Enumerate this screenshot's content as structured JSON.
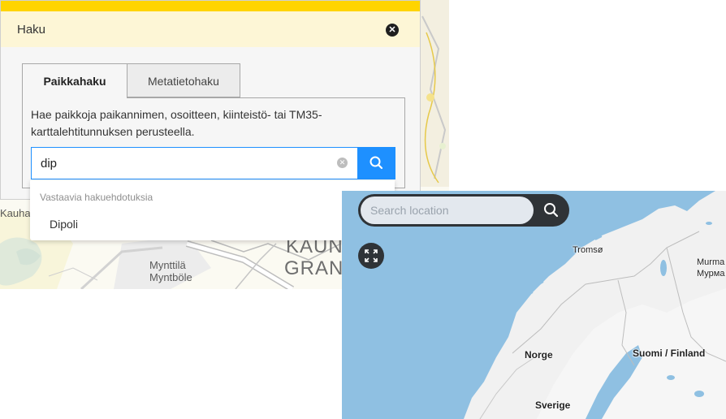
{
  "panel": {
    "title": "Haku",
    "close_icon": "close-icon",
    "accent_color": "#ffd400",
    "tabs": [
      {
        "label": "Paikkahaku",
        "active": true
      },
      {
        "label": "Metatietohaku",
        "active": false
      }
    ],
    "help_text": "Hae paikkoja paikannimen, osoitteen, kiinteistö- tai TM35-karttalehtitunnuksen perusteella.",
    "search": {
      "value": "dip",
      "clear_icon": "clear-icon",
      "button_icon": "search-icon",
      "button_color": "#1e90ff"
    },
    "suggestions": {
      "heading": "Vastaavia hakuehdotuksia",
      "items": [
        "Dipoli"
      ]
    }
  },
  "background_map": {
    "labels": [
      "Kauhal",
      "Mynttilä",
      "Myntböle",
      "KAUN",
      "GRAN"
    ]
  },
  "location_map": {
    "search_placeholder": "Search location",
    "search_icon": "search-icon",
    "fullscreen_icon": "fullscreen-icon",
    "water_color": "#8fc0e2",
    "labels": {
      "tromso": "Tromsø",
      "murm1": "Murma",
      "murm2": "Мурма",
      "norge": "Norge",
      "finland": "Suomi / Finland",
      "sverige": "Sverige"
    }
  }
}
